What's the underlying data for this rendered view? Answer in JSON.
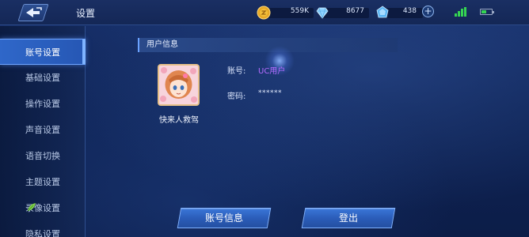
{
  "header": {
    "title": "设置",
    "back_icon": "back-arrow-icon"
  },
  "currencies": {
    "gold": "559K",
    "diamond": "8677",
    "coupon": "438"
  },
  "status": {
    "signal_bars": 4,
    "battery_level": 0.4,
    "signal_color": "#35d452"
  },
  "sidebar": {
    "items": [
      {
        "label": "账号设置",
        "active": true
      },
      {
        "label": "基础设置"
      },
      {
        "label": "操作设置"
      },
      {
        "label": "声音设置"
      },
      {
        "label": "语音切换"
      },
      {
        "label": "主题设置"
      },
      {
        "label": "录像设置",
        "icon": "leaf-icon"
      },
      {
        "label": "隐私设置"
      }
    ]
  },
  "user_info": {
    "section_title": "用户信息",
    "nickname": "快来人救驾",
    "account_label": "账号:",
    "account_value": "UC用户",
    "password_label": "密码:",
    "password_value": "******"
  },
  "buttons": {
    "account_info": "账号信息",
    "logout": "登出"
  },
  "colors": {
    "accent": "#2f67c9",
    "account_value": "#b56bff",
    "background": "#0f2456"
  }
}
